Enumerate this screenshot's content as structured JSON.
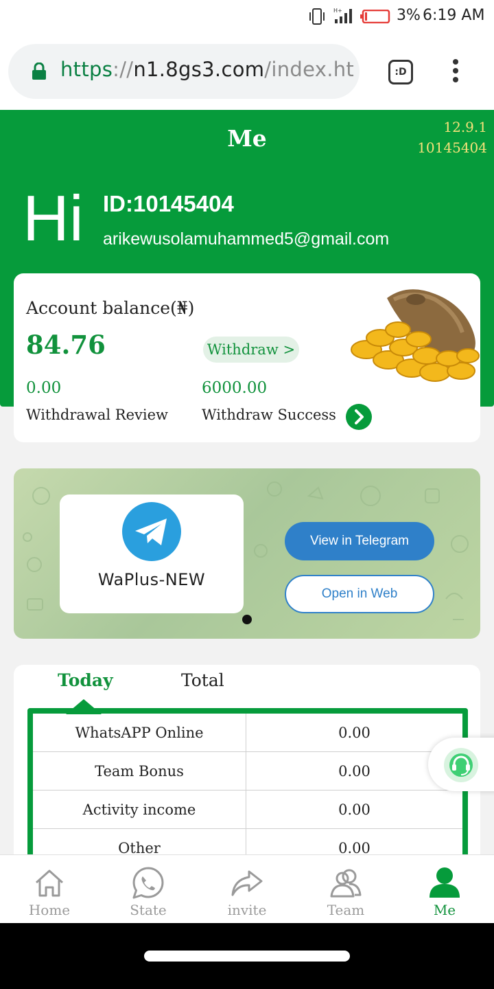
{
  "status_bar": {
    "battery_percent": "3%",
    "time": "6:19 AM",
    "battery_color": "#e53935"
  },
  "browser": {
    "url_scheme": "https",
    "url_sep": "://",
    "url_host": "n1.8gs3.com",
    "url_path": "/index.ht",
    "tab_switcher_label": ":D"
  },
  "header": {
    "title": "Me",
    "version": "12.9.1",
    "version_id": "10145404",
    "greeting": "Hi",
    "user_id": "ID:10145404",
    "email": "arikewusolamuhammed5@gmail.com"
  },
  "balance_card": {
    "label": "Account balance(₦)",
    "value": "84.76",
    "withdraw_button": "Withdraw >",
    "review_value": "0.00",
    "review_label": "Withdrawal Review",
    "success_value": "6000.00",
    "success_label": "Withdraw Success"
  },
  "banner": {
    "channel_name": "WaPlus-NEW",
    "view_button": "View in Telegram",
    "web_button": "Open in Web"
  },
  "earnings": {
    "tabs": [
      "Today",
      "Total"
    ],
    "active_tab": "Today",
    "rows": [
      {
        "label": "WhatsAPP Online",
        "value": "0.00"
      },
      {
        "label": "Team Bonus",
        "value": "0.00"
      },
      {
        "label": "Activity income",
        "value": "0.00"
      },
      {
        "label": "Other",
        "value": "0.00"
      }
    ]
  },
  "bottom_nav": {
    "items": [
      {
        "label": "Home",
        "icon": "home-icon"
      },
      {
        "label": "State",
        "icon": "whatsapp-icon"
      },
      {
        "label": "invite",
        "icon": "share-icon"
      },
      {
        "label": "Team",
        "icon": "team-icon"
      },
      {
        "label": "Me",
        "icon": "person-icon"
      }
    ],
    "active": "Me"
  },
  "colors": {
    "brand_green": "#069b3b",
    "text_green": "#11923c",
    "telegram_blue": "#2f80c9",
    "version_yellow": "#f6e27a"
  }
}
